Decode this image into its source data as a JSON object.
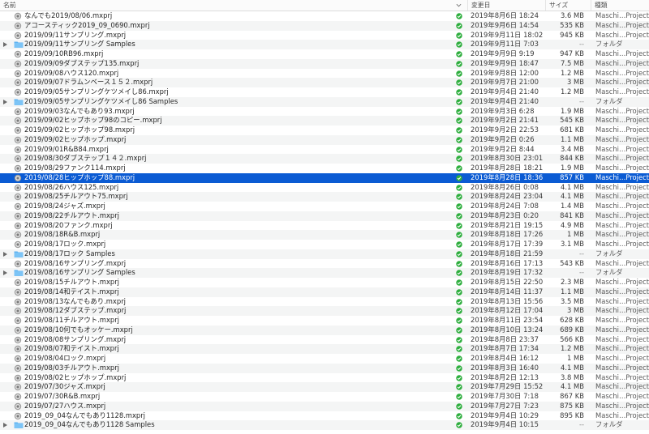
{
  "columns": {
    "name": "名前",
    "modified": "変更日",
    "size": "サイズ",
    "kind": "種類"
  },
  "colors": {
    "selection": "#0b5bd3",
    "sync_green": "#2eae3e",
    "folder_blue": "#5fb4f2"
  },
  "rows": [
    {
      "name": "なんでも2019/08/06.mxprj",
      "date": "2019年8月6日 18:24",
      "size": "3.6 MB",
      "kind": "Maschi…Project",
      "type": "file",
      "icon": "project-file-icon"
    },
    {
      "name": "アコースティック2019_09_0690.mxprj",
      "date": "2019年9月6日 14:54",
      "size": "535 KB",
      "kind": "Maschi…Project",
      "type": "file",
      "icon": "project-file-icon"
    },
    {
      "name": "2019/09/11サンプリング.mxprj",
      "date": "2019年9月11日 18:02",
      "size": "945 KB",
      "kind": "Maschi…Project",
      "type": "file",
      "icon": "project-file-icon"
    },
    {
      "name": "2019/09/11サンプリング Samples",
      "date": "2019年9月11日 7:03",
      "size": "--",
      "kind": "フォルダ",
      "type": "folder",
      "icon": "folder-icon"
    },
    {
      "name": "2019/09/10RB96.mxprj",
      "date": "2019年9月9日 9:19",
      "size": "947 KB",
      "kind": "Maschi…Project",
      "type": "file",
      "icon": "project-file-icon"
    },
    {
      "name": "2019/09/09ダブステップ135.mxprj",
      "date": "2019年9月9日 18:47",
      "size": "7.5 MB",
      "kind": "Maschi…Project",
      "type": "file",
      "icon": "project-file-icon"
    },
    {
      "name": "2019/09/08ハウス120.mxprj",
      "date": "2019年9月8日 12:00",
      "size": "1.2 MB",
      "kind": "Maschi…Project",
      "type": "file",
      "icon": "project-file-icon"
    },
    {
      "name": "2019/09/07ドラムンベース１５２.mxprj",
      "date": "2019年9月7日 21:00",
      "size": "3 MB",
      "kind": "Maschi…Project",
      "type": "file",
      "icon": "project-file-icon"
    },
    {
      "name": "2019/09/05サンプリングケツメイし86.mxprj",
      "date": "2019年9月4日 21:40",
      "size": "1.2 MB",
      "kind": "Maschi…Project",
      "type": "file",
      "icon": "project-file-icon"
    },
    {
      "name": "2019/09/05サンプリングケツメイし86 Samples",
      "date": "2019年9月4日 21:40",
      "size": "--",
      "kind": "フォルダ",
      "type": "folder",
      "icon": "folder-icon"
    },
    {
      "name": "2019/09/03なんでもあり93.mxprj",
      "date": "2019年9月3日 6:28",
      "size": "1.9 MB",
      "kind": "Maschi…Project",
      "type": "file",
      "icon": "project-file-icon"
    },
    {
      "name": "2019/09/02ヒップホップ98のコピー.mxprj",
      "date": "2019年9月2日 21:41",
      "size": "545 KB",
      "kind": "Maschi…Project",
      "type": "file",
      "icon": "project-file-icon"
    },
    {
      "name": "2019/09/02ヒップホップ98.mxprj",
      "date": "2019年9月2日 22:53",
      "size": "681 KB",
      "kind": "Maschi…Project",
      "type": "file",
      "icon": "project-file-icon"
    },
    {
      "name": "2019/09/02ヒップホップ.mxprj",
      "date": "2019年9月2日 0:26",
      "size": "1.1 MB",
      "kind": "Maschi…Project",
      "type": "file",
      "icon": "project-file-icon"
    },
    {
      "name": "2019/09/01R&B84.mxprj",
      "date": "2019年9月2日 8:44",
      "size": "3.4 MB",
      "kind": "Maschi…Project",
      "type": "file",
      "icon": "project-file-icon"
    },
    {
      "name": "2019/08/30ダブステップ１４２.mxprj",
      "date": "2019年8月30日 23:01",
      "size": "844 KB",
      "kind": "Maschi…Project",
      "type": "file",
      "icon": "project-file-icon"
    },
    {
      "name": "2019/08/29ファンク114.mxprj",
      "date": "2019年8月28日 18:21",
      "size": "1.9 MB",
      "kind": "Maschi…Project",
      "type": "file",
      "icon": "project-file-icon"
    },
    {
      "name": "2019/08/28ヒップホップ88.mxprj",
      "date": "2019年8月28日 18:36",
      "size": "857 KB",
      "kind": "Maschi…Project",
      "type": "file",
      "icon": "project-file-icon",
      "selected": true
    },
    {
      "name": "2019/08/26ハウス125.mxprj",
      "date": "2019年8月26日 0:08",
      "size": "4.1 MB",
      "kind": "Maschi…Project",
      "type": "file",
      "icon": "project-file-icon"
    },
    {
      "name": "2019/08/25チルアウト75.mxprj",
      "date": "2019年8月24日 23:04",
      "size": "4.1 MB",
      "kind": "Maschi…Project",
      "type": "file",
      "icon": "project-file-icon"
    },
    {
      "name": "2019/08/24ジャズ.mxprj",
      "date": "2019年8月24日 7:08",
      "size": "1.4 MB",
      "kind": "Maschi…Project",
      "type": "file",
      "icon": "project-file-icon"
    },
    {
      "name": "2019/08/22チルアウト.mxprj",
      "date": "2019年8月23日 0:20",
      "size": "841 KB",
      "kind": "Maschi…Project",
      "type": "file",
      "icon": "project-file-icon"
    },
    {
      "name": "2019/08/20ファンク.mxprj",
      "date": "2019年8月21日 19:15",
      "size": "4.9 MB",
      "kind": "Maschi…Project",
      "type": "file",
      "icon": "project-file-icon"
    },
    {
      "name": "2019/08/18R&B.mxprj",
      "date": "2019年8月18日 17:26",
      "size": "1 MB",
      "kind": "Maschi…Project",
      "type": "file",
      "icon": "project-file-icon"
    },
    {
      "name": "2019/08/17ロック.mxprj",
      "date": "2019年8月17日 17:39",
      "size": "3.1 MB",
      "kind": "Maschi…Project",
      "type": "file",
      "icon": "project-file-icon"
    },
    {
      "name": "2019/08/17ロック Samples",
      "date": "2019年8月18日 21:59",
      "size": "--",
      "kind": "フォルダ",
      "type": "folder",
      "icon": "folder-icon"
    },
    {
      "name": "2019/08/16サンプリング.mxprj",
      "date": "2019年8月16日 17:13",
      "size": "543 KB",
      "kind": "Maschi…Project",
      "type": "file",
      "icon": "project-file-icon"
    },
    {
      "name": "2019/08/16サンプリング Samples",
      "date": "2019年8月19日 17:32",
      "size": "--",
      "kind": "フォルダ",
      "type": "folder",
      "icon": "folder-icon"
    },
    {
      "name": "2019/08/15チルアウト.mxprj",
      "date": "2019年8月15日 22:50",
      "size": "2.3 MB",
      "kind": "Maschi…Project",
      "type": "file",
      "icon": "project-file-icon"
    },
    {
      "name": "2019/08/14和テイスト.mxprj",
      "date": "2019年8月14日 11:37",
      "size": "1.1 MB",
      "kind": "Maschi…Project",
      "type": "file",
      "icon": "project-file-icon"
    },
    {
      "name": "2019/08/13なんでもあり.mxprj",
      "date": "2019年8月13日 15:56",
      "size": "3.5 MB",
      "kind": "Maschi…Project",
      "type": "file",
      "icon": "project-file-icon"
    },
    {
      "name": "2019/08/12ダブステップ.mxprj",
      "date": "2019年8月12日 17:04",
      "size": "3 MB",
      "kind": "Maschi…Project",
      "type": "file",
      "icon": "project-file-icon"
    },
    {
      "name": "2019/08/11チルアウト.mxprj",
      "date": "2019年8月11日 23:54",
      "size": "628 KB",
      "kind": "Maschi…Project",
      "type": "file",
      "icon": "project-file-icon"
    },
    {
      "name": "2019/08/10何でもオッケー.mxprj",
      "date": "2019年8月10日 13:24",
      "size": "689 KB",
      "kind": "Maschi…Project",
      "type": "file",
      "icon": "project-file-icon"
    },
    {
      "name": "2019/08/08サンプリング.mxprj",
      "date": "2019年8月8日 23:37",
      "size": "566 KB",
      "kind": "Maschi…Project",
      "type": "file",
      "icon": "project-file-icon"
    },
    {
      "name": "2019/08/07和テイスト.mxprj",
      "date": "2019年8月7日 17:34",
      "size": "1.2 MB",
      "kind": "Maschi…Project",
      "type": "file",
      "icon": "project-file-icon"
    },
    {
      "name": "2019/08/04ロック.mxprj",
      "date": "2019年8月4日 16:12",
      "size": "1 MB",
      "kind": "Maschi…Project",
      "type": "file",
      "icon": "project-file-icon"
    },
    {
      "name": "2019/08/03チルアウト.mxprj",
      "date": "2019年8月3日 16:40",
      "size": "4.1 MB",
      "kind": "Maschi…Project",
      "type": "file",
      "icon": "project-file-icon"
    },
    {
      "name": "2019/08/02ヒップホップ.mxprj",
      "date": "2019年8月2日 12:13",
      "size": "3.8 MB",
      "kind": "Maschi…Project",
      "type": "file",
      "icon": "project-file-icon"
    },
    {
      "name": "2019/07/30ジャズ.mxprj",
      "date": "2019年7月29日 15:52",
      "size": "4.1 MB",
      "kind": "Maschi…Project",
      "type": "file",
      "icon": "project-file-icon"
    },
    {
      "name": "2019/07/30R&B.mxprj",
      "date": "2019年7月30日 7:18",
      "size": "867 KB",
      "kind": "Maschi…Project",
      "type": "file",
      "icon": "project-file-icon"
    },
    {
      "name": "2019/07/27ハウス.mxprj",
      "date": "2019年7月27日 7:23",
      "size": "875 KB",
      "kind": "Maschi…Project",
      "type": "file",
      "icon": "project-file-icon"
    },
    {
      "name": "2019_09_04なんでもあり1128.mxprj",
      "date": "2019年9月4日 10:29",
      "size": "895 KB",
      "kind": "Maschi…Project",
      "type": "file",
      "icon": "project-file-icon"
    },
    {
      "name": "2019_09_04なんでもあり1128 Samples",
      "date": "2019年9月4日 10:15",
      "size": "--",
      "kind": "フォルダ",
      "type": "folder",
      "icon": "folder-icon"
    }
  ]
}
